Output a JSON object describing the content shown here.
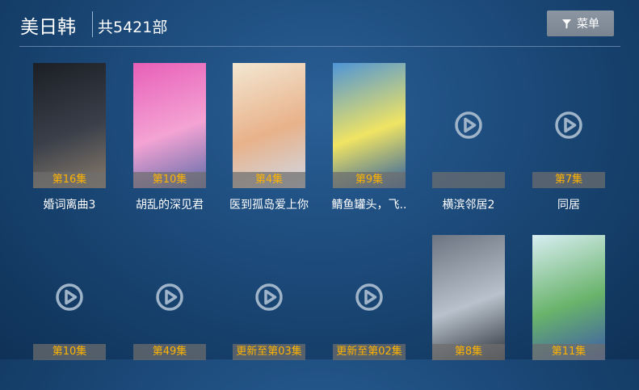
{
  "header": {
    "title": "美日韩",
    "count": "共5421部",
    "menu_label": "菜单"
  },
  "rows": [
    [
      {
        "episode": "第16集",
        "name": "婚词离曲3",
        "poster": "image",
        "palette": [
          "#1b1e24",
          "#3a3f4a",
          "#8a7d6c"
        ]
      },
      {
        "episode": "第10集",
        "name": "胡乱的深见君",
        "poster": "image",
        "palette": [
          "#e85fb8",
          "#f4a3d4",
          "#5d6ba8"
        ]
      },
      {
        "episode": "第4集",
        "name": "医到孤岛爱上你",
        "poster": "image",
        "palette": [
          "#f3e7d2",
          "#e8b28a",
          "#cfd8e6"
        ]
      },
      {
        "episode": "第9集",
        "name": "鲭鱼罐头，飞..",
        "poster": "image",
        "palette": [
          "#4f95d6",
          "#f0e463",
          "#2c5ea1"
        ]
      },
      {
        "episode": "",
        "name": "横滨邻居2",
        "poster": "placeholder"
      },
      {
        "episode": "第7集",
        "name": "同居",
        "poster": "placeholder"
      }
    ],
    [
      {
        "episode": "第10集",
        "name": "",
        "poster": "placeholder"
      },
      {
        "episode": "第49集",
        "name": "",
        "poster": "placeholder"
      },
      {
        "episode": "更新至第03集",
        "name": "",
        "poster": "placeholder"
      },
      {
        "episode": "更新至第02集",
        "name": "",
        "poster": "placeholder"
      },
      {
        "episode": "第8集",
        "name": "",
        "poster": "image",
        "palette": [
          "#6b7480",
          "#b9c2cc",
          "#2a2f38"
        ]
      },
      {
        "episode": "第11集",
        "name": "",
        "poster": "image",
        "palette": [
          "#d8eef2",
          "#69b36b",
          "#3c5aa8"
        ]
      }
    ]
  ],
  "colors": {
    "accent_episode": "#ffb400",
    "bg_center": "#2a5f96",
    "bg_edge": "#0f3157",
    "menu_bg": "#838d99"
  }
}
